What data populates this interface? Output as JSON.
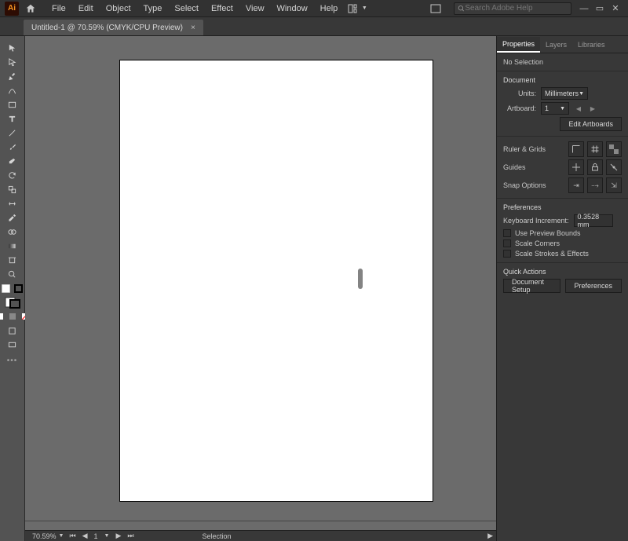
{
  "app": {
    "logo": "Ai"
  },
  "menu": [
    "File",
    "Edit",
    "Object",
    "Type",
    "Select",
    "Effect",
    "View",
    "Window",
    "Help"
  ],
  "search": {
    "placeholder": "Search Adobe Help"
  },
  "doc_tab": {
    "title": "Untitled-1 @ 70.59% (CMYK/CPU Preview)"
  },
  "status": {
    "zoom": "70.59%",
    "artboard_index": "1",
    "tool": "Selection"
  },
  "panel_tabs": [
    "Properties",
    "Layers",
    "Libraries"
  ],
  "properties": {
    "selection": "No Selection",
    "document_title": "Document",
    "units_label": "Units:",
    "units_value": "Millimeters",
    "artboard_label": "Artboard:",
    "artboard_value": "1",
    "edit_artboards": "Edit Artboards",
    "ruler_grids": "Ruler & Grids",
    "guides": "Guides",
    "snap_options": "Snap Options",
    "preferences_title": "Preferences",
    "keyboard_increment_label": "Keyboard Increment:",
    "keyboard_increment_value": "0.3528 mm",
    "chk_preview": "Use Preview Bounds",
    "chk_scale_corners": "Scale Corners",
    "chk_scale_strokes": "Scale Strokes & Effects",
    "quick_actions": "Quick Actions",
    "doc_setup": "Document Setup",
    "preferences_btn": "Preferences"
  }
}
